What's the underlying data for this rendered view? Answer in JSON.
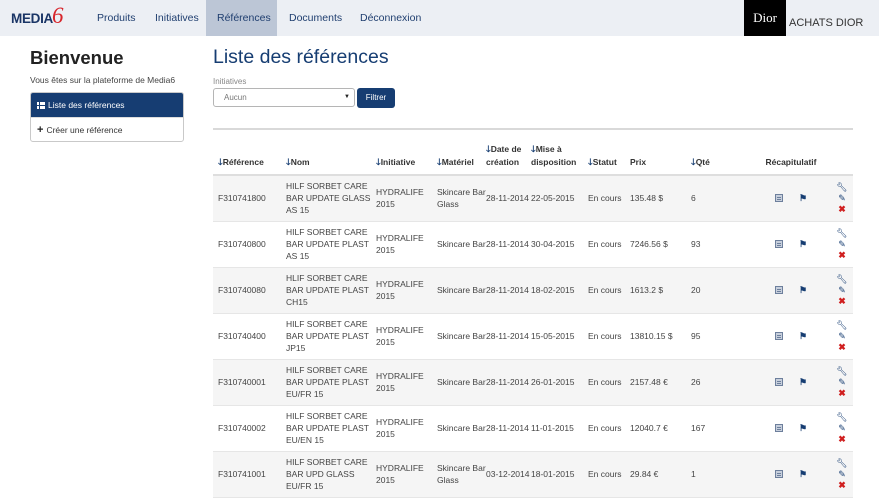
{
  "navbar": {
    "brand_text": "MEDIA",
    "brand_mark": "6",
    "items": [
      {
        "label": "Produits",
        "active": false
      },
      {
        "label": "Initiatives",
        "active": false
      },
      {
        "label": "Références",
        "active": true
      },
      {
        "label": "Documents",
        "active": false
      },
      {
        "label": "Déconnexion",
        "active": false
      }
    ],
    "client_logo_text": "Dior",
    "client_label": "ACHATS DIOR"
  },
  "sidebar": {
    "title": "Bienvenue",
    "subtitle": "Vous êtes sur la plateforme de Media6",
    "menu": [
      {
        "label": "Liste des références",
        "icon": "list-icon",
        "active": true
      },
      {
        "label": "Créer une référence",
        "icon": "plus-icon",
        "active": false
      }
    ]
  },
  "main": {
    "title": "Liste des références",
    "filter": {
      "label": "Initiatives",
      "selected": "Aucun",
      "button": "Filtrer"
    },
    "table": {
      "columns": [
        {
          "label": "Référence",
          "sortable": true
        },
        {
          "label": "Nom",
          "sortable": true
        },
        {
          "label": "Initiative",
          "sortable": true
        },
        {
          "label": "Matériel",
          "sortable": true
        },
        {
          "label": "Date de création",
          "sortable": true
        },
        {
          "label": "Mise à disposition",
          "sortable": true
        },
        {
          "label": "Statut",
          "sortable": true
        },
        {
          "label": "Prix",
          "sortable": false
        },
        {
          "label": "Qté",
          "sortable": true
        },
        {
          "label": "Récapitulatif",
          "sortable": false
        },
        {
          "label": "",
          "sortable": false
        }
      ],
      "sort_arrow": "🡓",
      "rows": [
        {
          "reference": "F310741800",
          "nom": "HILF SORBET CARE BAR UPDATE GLASS AS 15",
          "initiative": "HYDRALIFE 2015",
          "materiel": "Skincare Bar Glass",
          "date_creation": "28-11-2014",
          "mise_a_disposition": "22-05-2015",
          "statut": "En cours",
          "prix": "135.48 $",
          "qte": "6"
        },
        {
          "reference": "F310740800",
          "nom": "HILF SORBET CARE BAR UPDATE PLAST AS 15",
          "initiative": "HYDRALIFE 2015",
          "materiel": "Skincare Bar",
          "date_creation": "28-11-2014",
          "mise_a_disposition": "30-04-2015",
          "statut": "En cours",
          "prix": "7246.56 $",
          "qte": "93"
        },
        {
          "reference": "F310740080",
          "nom": "HLIF SORBET CARE BAR UPDATE PLAST CH15",
          "initiative": "HYDRALIFE 2015",
          "materiel": "Skincare Bar",
          "date_creation": "28-11-2014",
          "mise_a_disposition": "18-02-2015",
          "statut": "En cours",
          "prix": "1613.2 $",
          "qte": "20"
        },
        {
          "reference": "F310740400",
          "nom": "HILF SORBET CARE BAR UPDATE PLAST JP15",
          "initiative": "HYDRALIFE 2015",
          "materiel": "Skincare Bar",
          "date_creation": "28-11-2014",
          "mise_a_disposition": "15-05-2015",
          "statut": "En cours",
          "prix": "13810.15 $",
          "qte": "95"
        },
        {
          "reference": "F310740001",
          "nom": "HILF SORBET CARE BAR UPDATE PLAST EU/FR 15",
          "initiative": "HYDRALIFE 2015",
          "materiel": "Skincare Bar",
          "date_creation": "28-11-2014",
          "mise_a_disposition": "26-01-2015",
          "statut": "En cours",
          "prix": "2157.48 €",
          "qte": "26"
        },
        {
          "reference": "F310740002",
          "nom": "HILF SORBET CARE BAR UPDATE PLAST EU/EN 15",
          "initiative": "HYDRALIFE 2015",
          "materiel": "Skincare Bar",
          "date_creation": "28-11-2014",
          "mise_a_disposition": "11-01-2015",
          "statut": "En cours",
          "prix": "12040.7 €",
          "qte": "167"
        },
        {
          "reference": "F310741001",
          "nom": "HILF SORBET CARE BAR UPD GLASS EU/FR 15",
          "initiative": "HYDRALIFE 2015",
          "materiel": "Skincare Bar Glass",
          "date_creation": "03-12-2014",
          "mise_a_disposition": "18-01-2015",
          "statut": "En cours",
          "prix": "29.84 €",
          "qte": "1"
        }
      ],
      "row_icons": {
        "recap": "summary-icon",
        "flow": "workflow-icon",
        "actions": [
          "wrench-icon",
          "pencil-icon",
          "delete-icon"
        ]
      }
    }
  },
  "colors": {
    "brand_navy": "#163d72",
    "nav_bg": "#eceff4",
    "nav_active_bg": "#bcc6d6",
    "brand_red": "#d7262c",
    "delete_red": "#d01f1f",
    "row_stripe": "#f5f5f5"
  }
}
